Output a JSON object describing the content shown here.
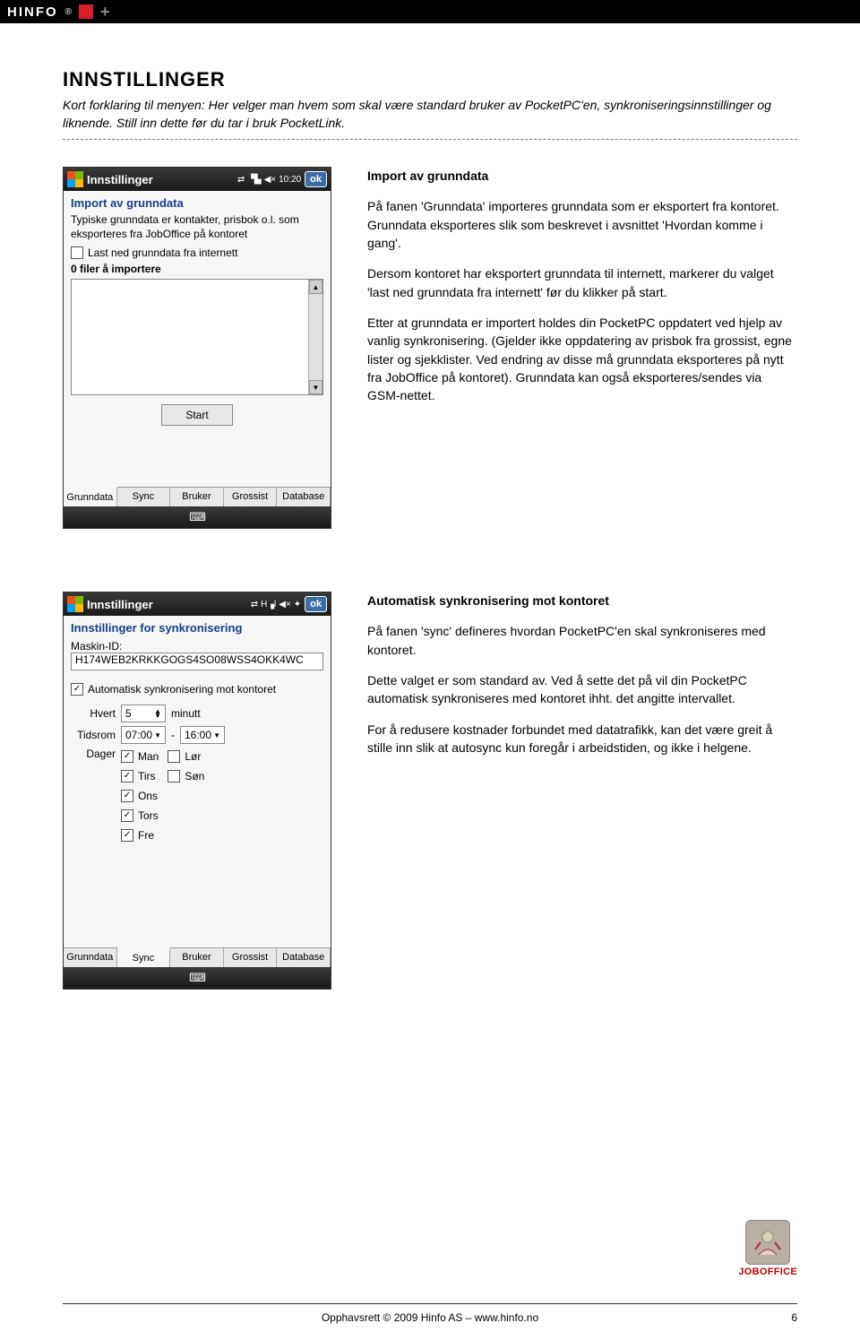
{
  "topbar": {
    "brand": "HINFO",
    "reg": "®"
  },
  "heading": "INNSTILLINGER",
  "intro": "Kort forklaring til menyen: Her velger man hvem som skal være standard bruker av PocketPC'en, synkroniseringsinnstillinger og liknende. Still inn dette før du tar i bruk PocketLink.",
  "section1": {
    "title": "Import av grunndata",
    "p1": "På fanen 'Grunndata' importeres grunndata som er eksportert fra kontoret. Grunndata eksporteres slik som beskrevet i avsnittet 'Hvordan komme i gang'.",
    "p2": "Dersom kontoret har eksportert grunndata til internett, markerer du valget 'last ned grunndata fra internett' før du klikker på start.",
    "p3": "Etter at grunndata er importert holdes din PocketPC oppdatert ved hjelp av vanlig synkronisering. (Gjelder ikke oppdatering av prisbok fra grossist, egne lister og sjekklister. Ved endring av disse må grunndata eksporteres på nytt fra JobOffice på kontoret). Grunndata kan også eksporteres/sendes via GSM-nettet."
  },
  "ppc1": {
    "title": "Innstillinger",
    "time": "10:20",
    "ok": "ok",
    "subtitle": "Import av grunndata",
    "desc": "Typiske grunndata er kontakter, prisbok o.l. som eksporteres fra JobOffice på kontoret",
    "chk": "Last ned grunndata fra internett",
    "files": "0 filer å importere",
    "btn": "Start",
    "tabs": [
      "Grunndata",
      "Sync",
      "Bruker",
      "Grossist",
      "Database"
    ],
    "active_tab": 0
  },
  "section2": {
    "title": "Automatisk synkronisering mot kontoret",
    "p1": "På fanen 'sync' defineres hvordan PocketPC'en skal synkroniseres med kontoret.",
    "p2": "Dette valget er som standard av. Ved å sette det på vil din PocketPC automatisk synkroniseres med kontoret ihht. det angitte intervallet.",
    "p3": "For å redusere kostnader forbundet med datatrafikk, kan det være greit å stille inn slik at autosync kun foregår i arbeidstiden, og ikke i helgene."
  },
  "ppc2": {
    "title": "Innstillinger",
    "ok": "ok",
    "subtitle": "Innstillinger for synkronisering",
    "maskin_lbl": "Maskin-ID:",
    "maskin_val": "H174WEB2KRKKGOGS4SO08WSS4OKK4WC",
    "autosync": "Automatisk synkronisering mot kontoret",
    "hvert_lbl": "Hvert",
    "hvert_val": "5",
    "hvert_unit": "minutt",
    "tidsrom_lbl": "Tidsrom",
    "tidsrom_from": "07:00",
    "tidsrom_to": "16:00",
    "dager_lbl": "Dager",
    "days_left": [
      {
        "l": "Man",
        "c": true
      },
      {
        "l": "Tirs",
        "c": true
      },
      {
        "l": "Ons",
        "c": true
      },
      {
        "l": "Tors",
        "c": true
      },
      {
        "l": "Fre",
        "c": true
      }
    ],
    "days_right": [
      {
        "l": "Lør",
        "c": false
      },
      {
        "l": "Søn",
        "c": false
      }
    ],
    "tabs": [
      "Grunndata",
      "Sync",
      "Bruker",
      "Grossist",
      "Database"
    ],
    "active_tab": 1
  },
  "footer": {
    "logo_text": "JOBOFFICE",
    "copyright": "Opphavsrett © 2009 Hinfo AS – www.hinfo.no",
    "page": "6"
  }
}
